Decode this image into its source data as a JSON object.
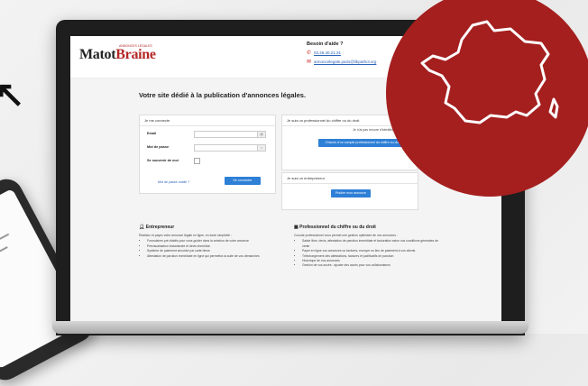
{
  "header": {
    "logo_part1": "Matot",
    "logo_part2": "Braine",
    "logo_sub": "ANNONCES LÉGALES",
    "help_title": "Besoin d'aide ?",
    "phone": "03.26.40.21.31",
    "email": "annoncelegale.paris@libpathol.org"
  },
  "main": {
    "tagline": "Votre site dédié à la publication d'annonces légales.",
    "login": {
      "panel_title": "Je me connecte",
      "email_label": "Email",
      "password_label": "Mot de passe",
      "remember_label": "Se souvenir de moi",
      "forgot_link": "Mot de passe oublié ?",
      "submit": "Se connecter"
    },
    "pro": {
      "panel_title": "Je suis un professionnel du chiffre ou du droit",
      "note": "Je n'ai pas encore d'identifiant",
      "button": "J'inscris d'un compte professionnel du chiffre ou du droit"
    },
    "entrepreneur": {
      "panel_title": "Je suis un entrepreneur",
      "button": "Publier mon annonce"
    }
  },
  "info": {
    "left_title": "Entrepreneur",
    "left_intro": "Réalisez et payez votre annonce légale en ligne, en toute simplicité :",
    "left_items": [
      "Formulaires pré-établis pour vous guider dans la création de votre annonce",
      "Précisualisation instantanée et devis immédiat",
      "Système de paiement sécurisé par carte bleue",
      "Attestation de parution immédiate en ligne qui permettra la suite de vos démarches"
    ],
    "right_title": "Professionnel du chiffre ou du droit",
    "right_intro": "Cocode professionnel vous permet une gestion optimisée de vos annonces :",
    "right_items": [
      "Saisie libre, devis, attestation de parution immédiate et facturation selon vos conditions générales de vente",
      "Payer en ligne vos annonces ou factures, envoyer un lien de paiement à vos clients",
      "Téléchargement des attestations, factures et justificatifs de parution",
      "Historique de vos annonces",
      "Gestion de vos accès : ajouter des accès pour vos collaborateurs"
    ]
  },
  "colors": {
    "brand_red": "#b52727",
    "badge_red": "#a51f1f",
    "button_blue": "#2e7fd6"
  },
  "icons": [
    "phone-icon",
    "mail-icon",
    "user-icon",
    "building-icon",
    "france-map-icon",
    "arrow-icon"
  ]
}
